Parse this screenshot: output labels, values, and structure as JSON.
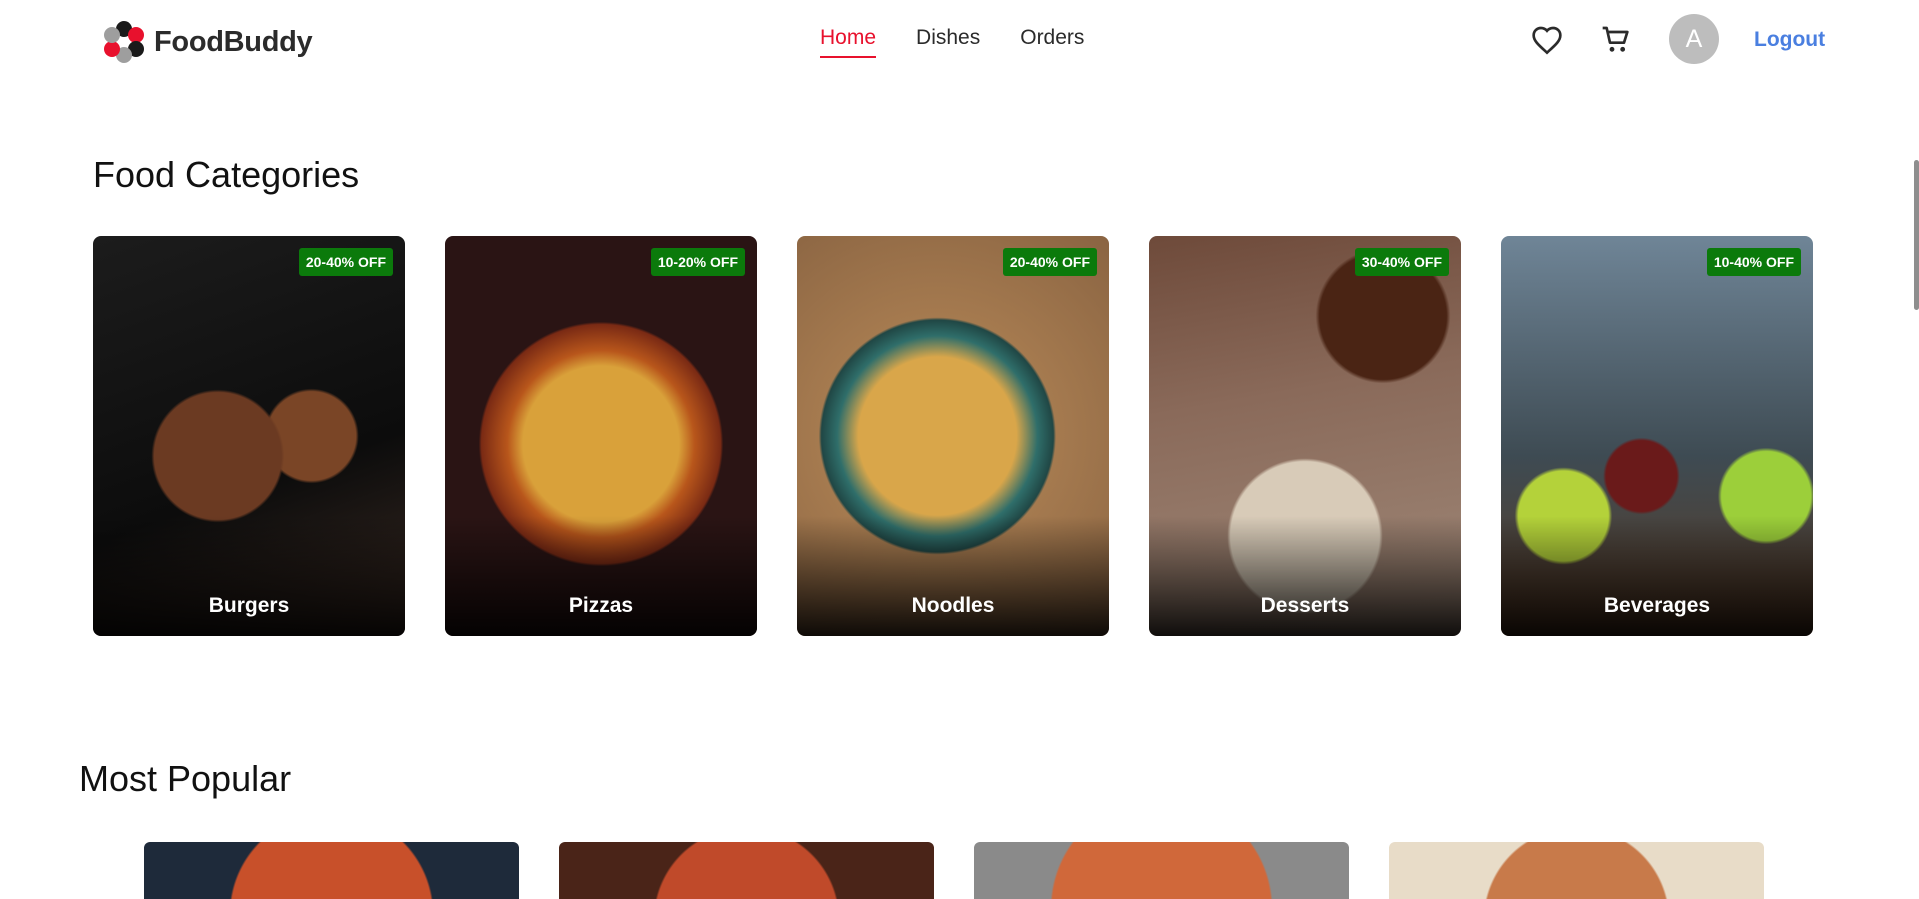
{
  "brand": {
    "name": "FoodBuddy"
  },
  "nav": {
    "items": [
      {
        "label": "Home",
        "active": true
      },
      {
        "label": "Dishes",
        "active": false
      },
      {
        "label": "Orders",
        "active": false
      }
    ]
  },
  "actions": {
    "wishlist_icon": "heart-icon",
    "cart_icon": "cart-icon",
    "avatar_initial": "A",
    "logout_label": "Logout"
  },
  "categories": {
    "title": "Food Categories",
    "items": [
      {
        "name": "Burgers",
        "discount": "20-40% OFF"
      },
      {
        "name": "Pizzas",
        "discount": "10-20% OFF"
      },
      {
        "name": "Noodles",
        "discount": "20-40% OFF"
      },
      {
        "name": "Desserts",
        "discount": "30-40% OFF"
      },
      {
        "name": "Beverages",
        "discount": "10-40% OFF"
      }
    ]
  },
  "popular": {
    "title": "Most Popular",
    "item_count": 4
  },
  "colors": {
    "accent": "#e8112d",
    "link": "#4a7fe0",
    "badge": "#0b7a0b",
    "avatar": "#bdbdbd"
  }
}
